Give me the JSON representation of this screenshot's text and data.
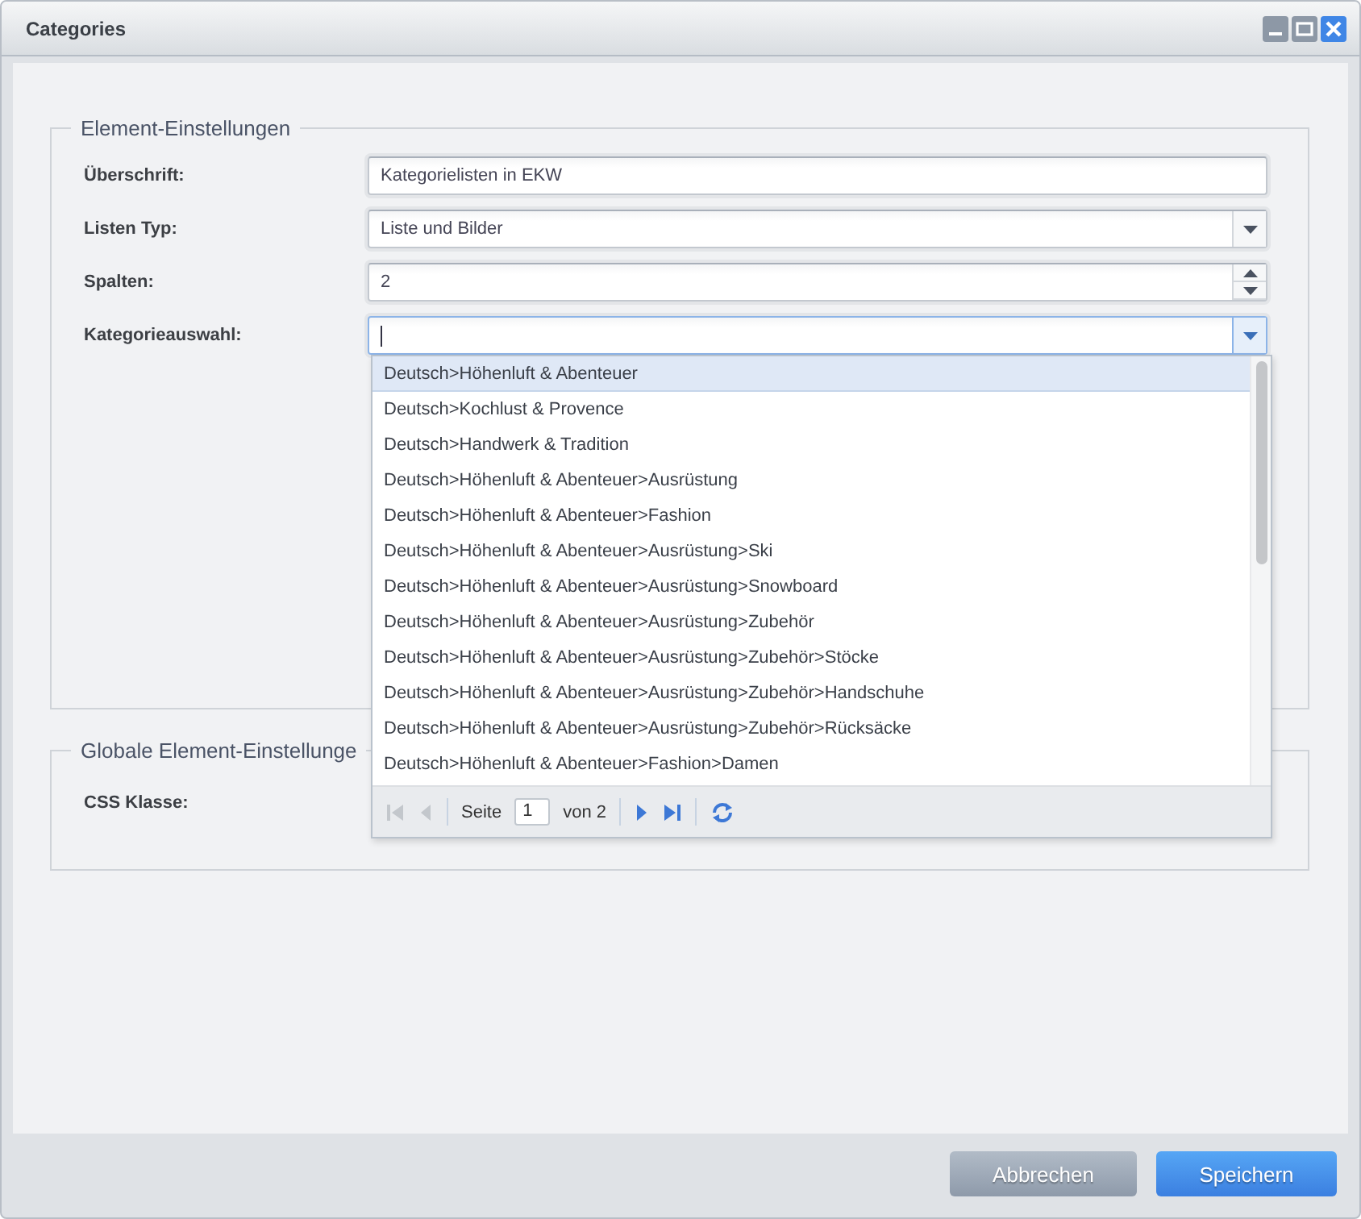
{
  "window": {
    "title": "Categories"
  },
  "fieldsets": [
    {
      "legend": "Element-Einstellungen",
      "fields": [
        {
          "label": "Überschrift:",
          "kind": "text",
          "value": "Kategorielisten in EKW",
          "focused": false
        },
        {
          "label": "Listen Typ:",
          "kind": "select",
          "value": "Liste und Bilder",
          "focused": false
        },
        {
          "label": "Spalten:",
          "kind": "spinner",
          "value": "2",
          "focused": false
        },
        {
          "label": "Kategorieauswahl:",
          "kind": "combo",
          "focused": true
        }
      ]
    },
    {
      "legend": "Globale Element-Einstellunge",
      "fields": [
        {
          "label": "CSS Klasse:",
          "kind": "hidden"
        }
      ]
    }
  ],
  "dropdown": {
    "items": [
      {
        "text": "Deutsch>Höhenluft & Abenteuer",
        "selected": true
      },
      {
        "text": "Deutsch>Kochlust & Provence",
        "selected": false
      },
      {
        "text": "Deutsch>Handwerk & Tradition",
        "selected": false
      },
      {
        "text": "Deutsch>Höhenluft & Abenteuer>Ausrüstung",
        "selected": false
      },
      {
        "text": "Deutsch>Höhenluft & Abenteuer>Fashion",
        "selected": false
      },
      {
        "text": "Deutsch>Höhenluft & Abenteuer>Ausrüstung>Ski",
        "selected": false
      },
      {
        "text": "Deutsch>Höhenluft & Abenteuer>Ausrüstung>Snowboard",
        "selected": false
      },
      {
        "text": "Deutsch>Höhenluft & Abenteuer>Ausrüstung>Zubehör",
        "selected": false
      },
      {
        "text": "Deutsch>Höhenluft & Abenteuer>Ausrüstung>Zubehör>Stöcke",
        "selected": false
      },
      {
        "text": "Deutsch>Höhenluft & Abenteuer>Ausrüstung>Zubehör>Handschuhe",
        "selected": false
      },
      {
        "text": "Deutsch>Höhenluft & Abenteuer>Ausrüstung>Zubehör>Rücksäcke",
        "selected": false
      },
      {
        "text": "Deutsch>Höhenluft & Abenteuer>Fashion>Damen",
        "selected": false
      }
    ],
    "pager": {
      "page_label": "Seite",
      "page": "1",
      "total": "von 2"
    }
  },
  "buttons": [
    {
      "label": "Abbrechen",
      "kind": "secondary"
    },
    {
      "label": "Speichern",
      "kind": "primary"
    }
  ]
}
